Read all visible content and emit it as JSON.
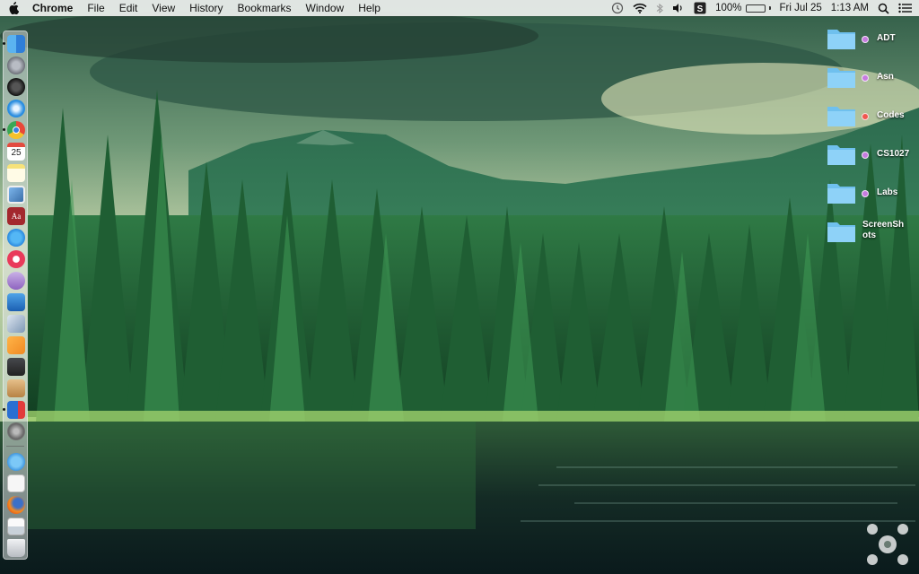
{
  "menubar": {
    "app_name": "Chrome",
    "menus": [
      "File",
      "Edit",
      "View",
      "History",
      "Bookmarks",
      "Window",
      "Help"
    ],
    "battery_percent": "100%",
    "battery_level": 1.0,
    "date": "Fri Jul 25",
    "time": "1:13 AM",
    "status_icons": [
      "time-machine-icon",
      "wifi-icon",
      "bluetooth-icon",
      "volume-icon",
      "app-s-icon",
      "battery-icon",
      "spotlight-icon",
      "notification-center-icon"
    ]
  },
  "dock": {
    "apps": [
      "finder-icon",
      "launchpad-icon",
      "dashboard-icon",
      "safari-icon",
      "chrome-icon",
      "calendar-icon",
      "notes-icon",
      "preview-icon",
      "dictionary-icon",
      "app-store-icon",
      "itunes-icon",
      "siri-orb-icon",
      "word-icon",
      "image-capture-icon",
      "pages-icon",
      "photo-booth-icon",
      "archive-utility-icon",
      "codes-app-icon",
      "system-preferences-icon"
    ],
    "calendar_day": "25",
    "dictionary_text": "Aa",
    "items_after_separator": [
      "app-store-downloads-icon",
      "document-stack-icon",
      "firefox-icon",
      "screenshot-stack-icon",
      "trash-icon"
    ]
  },
  "desktop": {
    "items": [
      {
        "label": "ADT",
        "tag_color": "#c77be0"
      },
      {
        "label": "Asn",
        "tag_color": "#c77be0"
      },
      {
        "label": "Codes",
        "tag_color": "#f0574f"
      },
      {
        "label": "CS1027",
        "tag_color": "#c77be0"
      },
      {
        "label": "Labs",
        "tag_color": "#c77be0"
      },
      {
        "label": "ScreenShots",
        "tag_color": ""
      }
    ],
    "folder_color": "#6fc0ee"
  }
}
